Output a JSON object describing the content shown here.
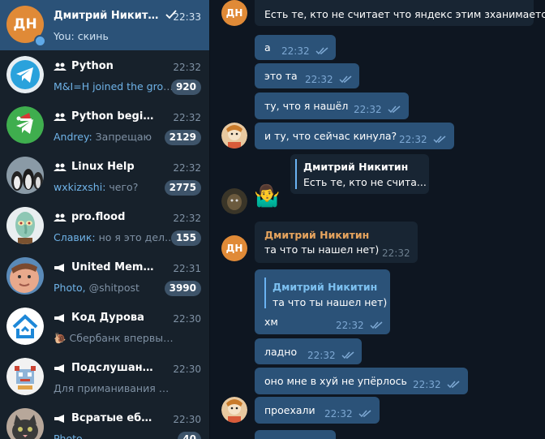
{
  "sidebar": {
    "chats": [
      {
        "title": "Дмитрий Никитин",
        "time": "22:33",
        "sender": "You:",
        "preview": "скинь",
        "initials": "ДН",
        "active": true,
        "type": "user",
        "online": true,
        "check": true,
        "icon": "initials-avatar"
      },
      {
        "title": "Python",
        "time": "22:32",
        "sender": "",
        "preview": "M&I=H joined the group",
        "badge": "920",
        "type": "group",
        "icon": "telegram-logo-avatar"
      },
      {
        "title": "Python beginners",
        "time": "22:32",
        "sender": "Andrey:",
        "preview": "Запрещаю",
        "badge": "2129",
        "type": "group",
        "icon": "telegram-santa-avatar"
      },
      {
        "title": "Linux Help",
        "time": "22:32",
        "sender": "wxkizxshi:",
        "preview": "чего?",
        "badge": "2775",
        "type": "group",
        "icon": "penguins-avatar"
      },
      {
        "title": "pro.flood",
        "time": "22:32",
        "sender": "Славик:",
        "preview": "но я это дела...",
        "badge": "155",
        "type": "group",
        "icon": "squidward-avatar"
      },
      {
        "title": "United Memes Fe...",
        "time": "22:31",
        "sender": "Photo,",
        "preview": "@shitpost",
        "badge": "3990",
        "type": "channel",
        "icon": "face-avatar"
      },
      {
        "title": "Код Дурова",
        "time": "22:30",
        "sender": "",
        "preview": "🐌 Сбербанк впервые за с...",
        "type": "channel",
        "icon": "house-logo-avatar"
      },
      {
        "title": "Подслушано у п...",
        "time": "22:30",
        "sender": "",
        "preview": "Для приманивания програ...",
        "type": "channel",
        "icon": "pixel-avatar"
      },
      {
        "title": "Всратые еблеты ...",
        "time": "22:30",
        "sender": "Photo,",
        "preview": "",
        "badge": "40",
        "type": "channel",
        "icon": "cat-avatar"
      }
    ]
  },
  "messages": {
    "top_msg": {
      "sender_initials": "ДН",
      "text": "Есть те, кто не считает что яндекс этим зханимается?"
    },
    "outgoing1": [
      {
        "text": "а",
        "time": "22:32"
      },
      {
        "text": "это та",
        "time": "22:32"
      },
      {
        "text": "ту, что я нашёл",
        "time": "22:32"
      },
      {
        "text": "и ту, что сейчас кинула?",
        "time": "22:32"
      }
    ],
    "forward": {
      "name": "Дмитрий Никитин",
      "text": "Есть те, кто не счита..."
    },
    "sticker": "🤷‍♂️",
    "incoming": {
      "initials": "ДН",
      "name": "Дмитрий Никитин",
      "text": "та что ты нашел нет)",
      "time": "22:32"
    },
    "reply_msg": {
      "reply_name": "Дмитрий Никитин",
      "reply_text": "та что ты нашел нет)",
      "text": "хм",
      "time": "22:32"
    },
    "outgoing2": [
      {
        "text": "ладно",
        "time": "22:32"
      },
      {
        "text": "оно мне в хуй не упёрлось",
        "time": "22:32"
      },
      {
        "text": "проехали",
        "time": "22:32"
      }
    ]
  },
  "colors": {
    "accent": "#2b5278",
    "sidebar": "#17212b",
    "chat_bg": "#0e1621",
    "sender_orange": "#e6a45e",
    "link_blue": "#6ab2f2"
  }
}
